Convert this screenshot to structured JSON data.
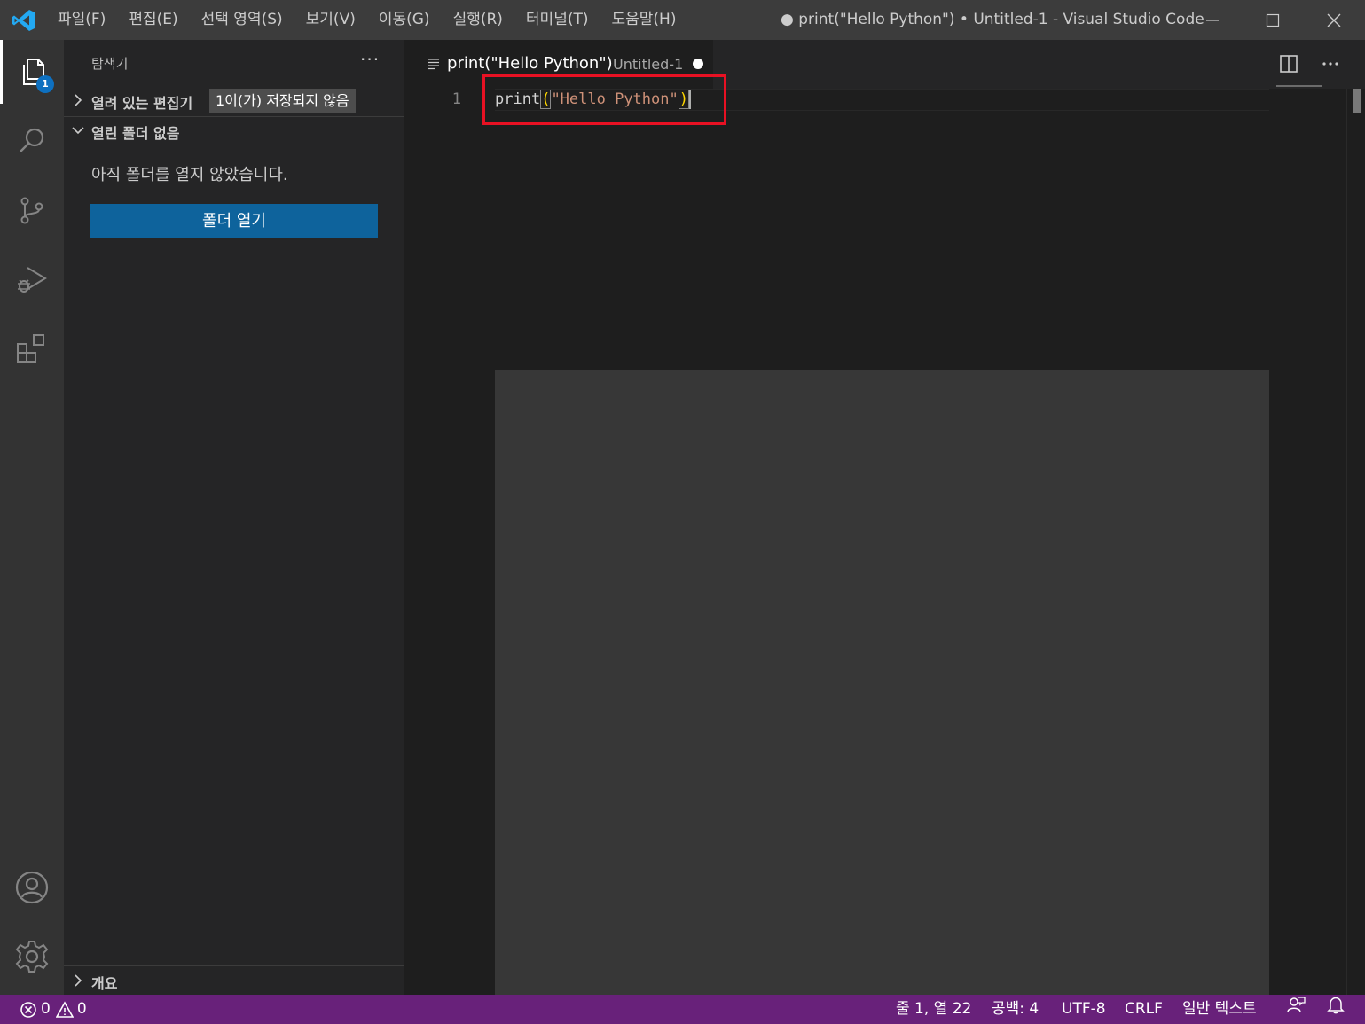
{
  "titlebar": {
    "menus": [
      "파일(F)",
      "편집(E)",
      "선택 영역(S)",
      "보기(V)",
      "이동(G)",
      "실행(R)",
      "터미널(T)",
      "도움말(H)"
    ],
    "title": "● print(\"Hello Python\") • Untitled-1 - Visual Studio Code"
  },
  "activity": {
    "explorer_badge": "1"
  },
  "sidebar": {
    "title": "탐색기",
    "more": "···",
    "open_editors_label": "열려 있는 편집기",
    "unsaved_badge": "1이(가) 저장되지 않음",
    "no_folder_label": "열린 폴더 없음",
    "no_folder_message": "아직 폴더를 열지 않았습니다.",
    "open_folder_button": "폴더 열기",
    "outline_label": "개요"
  },
  "editor": {
    "tab_name": "print(\"Hello Python\")",
    "tab_description": "Untitled-1",
    "line_number": "1",
    "code_fn": "print",
    "code_open": "(",
    "code_str": "\"Hello Python\"",
    "code_close": ")"
  },
  "statusbar": {
    "errors": "0",
    "warnings": "0",
    "position": "줄 1, 열 22",
    "spaces": "공백: 4",
    "encoding": "UTF-8",
    "eol": "CRLF",
    "language": "일반 텍스트"
  },
  "colors": {
    "accent_status": "#68217a",
    "button_blue": "#0e639c",
    "highlight_box": "#e81123"
  }
}
